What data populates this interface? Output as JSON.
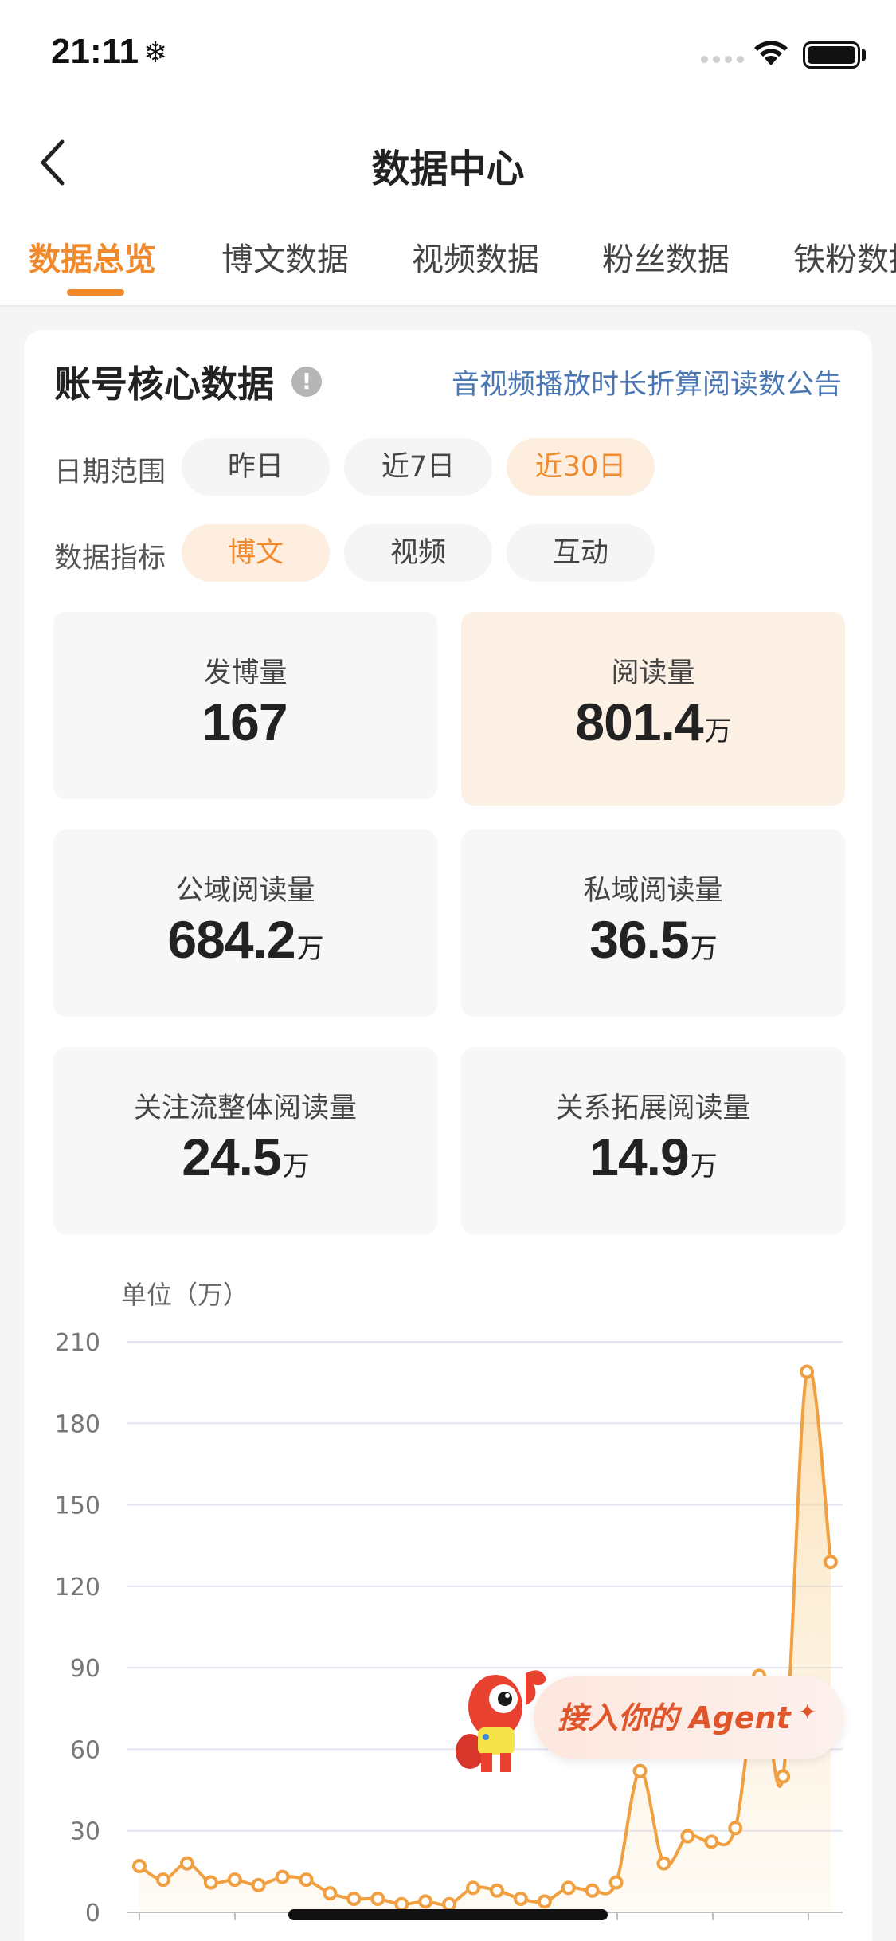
{
  "status_bar": {
    "time": "21:11",
    "snow_glyph": "❄"
  },
  "nav": {
    "title": "数据中心",
    "back_icon": "chevron-left-icon"
  },
  "tabs": [
    {
      "label": "数据总览",
      "active": true
    },
    {
      "label": "博文数据",
      "active": false
    },
    {
      "label": "视频数据",
      "active": false
    },
    {
      "label": "粉丝数据",
      "active": false
    },
    {
      "label": "铁粉数据",
      "active": false
    }
  ],
  "card": {
    "title": "账号核心数据",
    "info_glyph": "!",
    "notice_link": "音视频播放时长折算阅读数公告",
    "date_range": {
      "label": "日期范围",
      "options": [
        "昨日",
        "近7日",
        "近30日"
      ],
      "selected": "近30日"
    },
    "metric_type": {
      "label": "数据指标",
      "options": [
        "博文",
        "视频",
        "互动"
      ],
      "selected": "博文"
    },
    "metrics": [
      {
        "label": "发博量",
        "value": "167",
        "unit": ""
      },
      {
        "label": "阅读量",
        "value": "801.4",
        "unit": "万"
      },
      {
        "label": "公域阅读量",
        "value": "684.2",
        "unit": "万"
      },
      {
        "label": "私域阅读量",
        "value": "36.5",
        "unit": "万"
      },
      {
        "label": "关注流整体阅读量",
        "value": "24.5",
        "unit": "万"
      },
      {
        "label": "关系拓展阅读量",
        "value": "14.9",
        "unit": "万"
      }
    ]
  },
  "agent_banner": {
    "text": "接入你的 Agent",
    "sparkle": "✦"
  },
  "colors": {
    "accent": "#f08a2c",
    "link": "#4a77b4",
    "line": "#f0a040"
  },
  "chart_data": {
    "type": "line",
    "ylabel": "单位（万）",
    "ylim": [
      0,
      210
    ],
    "yticks": [
      0,
      30,
      60,
      90,
      120,
      150,
      180,
      210
    ],
    "series": [
      {
        "values": [
          17,
          12,
          18,
          11,
          12,
          10,
          13,
          12,
          7,
          5,
          5,
          3,
          4,
          3,
          9,
          8,
          5,
          4,
          9,
          8,
          11,
          52,
          18,
          28,
          26,
          31,
          87,
          50,
          199,
          129
        ]
      }
    ],
    "grid": true
  }
}
